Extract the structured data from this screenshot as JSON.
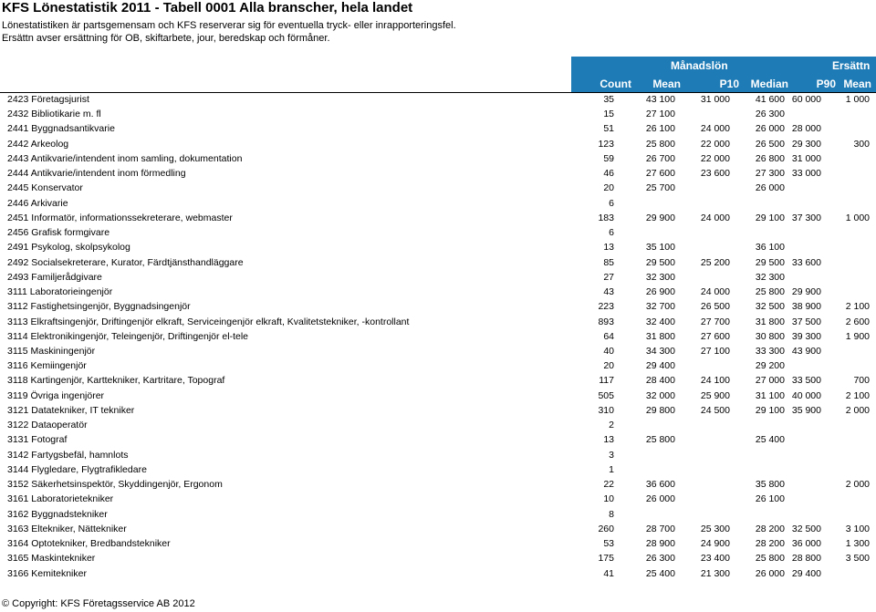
{
  "title": "KFS Lönestatistik 2011 - Tabell 0001 Alla branscher, hela landet",
  "notes": [
    "Lönestatistiken är partsgemensam och KFS reserverar sig för eventuella tryck- eller inrapporteringsfel.",
    "Ersättn avser ersättning för OB, skiftarbete, jour, beredskap och förmåner."
  ],
  "table": {
    "group_headers": {
      "salary": "Månadslön",
      "compensation": "Ersättn"
    },
    "columns": [
      "Count",
      "Mean",
      "P10",
      "Median",
      "P90",
      "Mean"
    ],
    "rows": [
      {
        "name": "2423 Företagsjurist",
        "count": "35",
        "mean": "43 100",
        "p10": "31 000",
        "median": "41 600",
        "p90": "60 000",
        "mean2": "1 000"
      },
      {
        "name": "2432 Bibliotikarie m. fl",
        "count": "15",
        "mean": "27 100",
        "p10": "",
        "median": "26 300",
        "p90": "",
        "mean2": ""
      },
      {
        "name": "2441 Byggnadsantikvarie",
        "count": "51",
        "mean": "26 100",
        "p10": "24 000",
        "median": "26 000",
        "p90": "28 000",
        "mean2": ""
      },
      {
        "name": "2442 Arkeolog",
        "count": "123",
        "mean": "25 800",
        "p10": "22 000",
        "median": "26 500",
        "p90": "29 300",
        "mean2": "300"
      },
      {
        "name": "2443 Antikvarie/intendent inom samling, dokumentation",
        "count": "59",
        "mean": "26 700",
        "p10": "22 000",
        "median": "26 800",
        "p90": "31 000",
        "mean2": ""
      },
      {
        "name": "2444 Antikvarie/intendent inom förmedling",
        "count": "46",
        "mean": "27 600",
        "p10": "23 600",
        "median": "27 300",
        "p90": "33 000",
        "mean2": ""
      },
      {
        "name": "2445 Konservator",
        "count": "20",
        "mean": "25 700",
        "p10": "",
        "median": "26 000",
        "p90": "",
        "mean2": ""
      },
      {
        "name": "2446 Arkivarie",
        "count": "6",
        "mean": "",
        "p10": "",
        "median": "",
        "p90": "",
        "mean2": ""
      },
      {
        "name": "2451 Informatör, informationssekreterare, webmaster",
        "count": "183",
        "mean": "29 900",
        "p10": "24 000",
        "median": "29 100",
        "p90": "37 300",
        "mean2": "1 000"
      },
      {
        "name": "2456 Grafisk formgivare",
        "count": "6",
        "mean": "",
        "p10": "",
        "median": "",
        "p90": "",
        "mean2": ""
      },
      {
        "name": "2491 Psykolog, skolpsykolog",
        "count": "13",
        "mean": "35 100",
        "p10": "",
        "median": "36 100",
        "p90": "",
        "mean2": ""
      },
      {
        "name": "2492 Socialsekreterare, Kurator, Färdtjänsthandläggare",
        "count": "85",
        "mean": "29 500",
        "p10": "25 200",
        "median": "29 500",
        "p90": "33 600",
        "mean2": ""
      },
      {
        "name": "2493 Familjerådgivare",
        "count": "27",
        "mean": "32 300",
        "p10": "",
        "median": "32 300",
        "p90": "",
        "mean2": ""
      },
      {
        "name": "3111 Laboratorieingenjör",
        "count": "43",
        "mean": "26 900",
        "p10": "24 000",
        "median": "25 800",
        "p90": "29 900",
        "mean2": ""
      },
      {
        "name": "3112 Fastighetsingenjör, Byggnadsingenjör",
        "count": "223",
        "mean": "32 700",
        "p10": "26 500",
        "median": "32 500",
        "p90": "38 900",
        "mean2": "2 100"
      },
      {
        "name": "3113 Elkraftsingenjör, Driftingenjör elkraft, Serviceingenjör elkraft, Kvalitetstekniker, -kontrollant",
        "count": "893",
        "mean": "32 400",
        "p10": "27 700",
        "median": "31 800",
        "p90": "37 500",
        "mean2": "2 600"
      },
      {
        "name": "3114 Elektronikingenjör, Teleingenjör, Driftingenjör el-tele",
        "count": "64",
        "mean": "31 800",
        "p10": "27 600",
        "median": "30 800",
        "p90": "39 300",
        "mean2": "1 900"
      },
      {
        "name": "3115 Maskiningenjör",
        "count": "40",
        "mean": "34 300",
        "p10": "27 100",
        "median": "33 300",
        "p90": "43 900",
        "mean2": ""
      },
      {
        "name": "3116 Kemiingenjör",
        "count": "20",
        "mean": "29 400",
        "p10": "",
        "median": "29 200",
        "p90": "",
        "mean2": ""
      },
      {
        "name": "3118 Kartingenjör, Karttekniker, Kartritare, Topograf",
        "count": "117",
        "mean": "28 400",
        "p10": "24 100",
        "median": "27 000",
        "p90": "33 500",
        "mean2": "700"
      },
      {
        "name": "3119 Övriga ingenjörer",
        "count": "505",
        "mean": "32 000",
        "p10": "25 900",
        "median": "31 100",
        "p90": "40 000",
        "mean2": "2 100"
      },
      {
        "name": "3121 Datatekniker, IT tekniker",
        "count": "310",
        "mean": "29 800",
        "p10": "24 500",
        "median": "29 100",
        "p90": "35 900",
        "mean2": "2 000"
      },
      {
        "name": "3122 Dataoperatör",
        "count": "2",
        "mean": "",
        "p10": "",
        "median": "",
        "p90": "",
        "mean2": ""
      },
      {
        "name": "3131 Fotograf",
        "count": "13",
        "mean": "25 800",
        "p10": "",
        "median": "25 400",
        "p90": "",
        "mean2": ""
      },
      {
        "name": "3142 Fartygsbefäl, hamnlots",
        "count": "3",
        "mean": "",
        "p10": "",
        "median": "",
        "p90": "",
        "mean2": ""
      },
      {
        "name": "3144 Flygledare, Flygtrafikledare",
        "count": "1",
        "mean": "",
        "p10": "",
        "median": "",
        "p90": "",
        "mean2": ""
      },
      {
        "name": "3152 Säkerhetsinspektör, Skyddingenjör, Ergonom",
        "count": "22",
        "mean": "36 600",
        "p10": "",
        "median": "35 800",
        "p90": "",
        "mean2": "2 000"
      },
      {
        "name": "3161 Laboratorietekniker",
        "count": "10",
        "mean": "26 000",
        "p10": "",
        "median": "26 100",
        "p90": "",
        "mean2": ""
      },
      {
        "name": "3162 Byggnadstekniker",
        "count": "8",
        "mean": "",
        "p10": "",
        "median": "",
        "p90": "",
        "mean2": ""
      },
      {
        "name": "3163 Eltekniker, Nättekniker",
        "count": "260",
        "mean": "28 700",
        "p10": "25 300",
        "median": "28 200",
        "p90": "32 500",
        "mean2": "3 100"
      },
      {
        "name": "3164 Optotekniker, Bredbandstekniker",
        "count": "53",
        "mean": "28 900",
        "p10": "24 900",
        "median": "28 200",
        "p90": "36 000",
        "mean2": "1 300"
      },
      {
        "name": "3165 Maskintekniker",
        "count": "175",
        "mean": "26 300",
        "p10": "23 400",
        "median": "25 800",
        "p90": "28 800",
        "mean2": "3 500"
      },
      {
        "name": "3166 Kemitekniker",
        "count": "41",
        "mean": "25 400",
        "p10": "21 300",
        "median": "26 000",
        "p90": "29 400",
        "mean2": ""
      }
    ]
  },
  "copyright": "© Copyright: KFS Företagsservice AB 2012",
  "colors": {
    "header_band": "#1e7bb6",
    "header_text": "#ffffff"
  }
}
